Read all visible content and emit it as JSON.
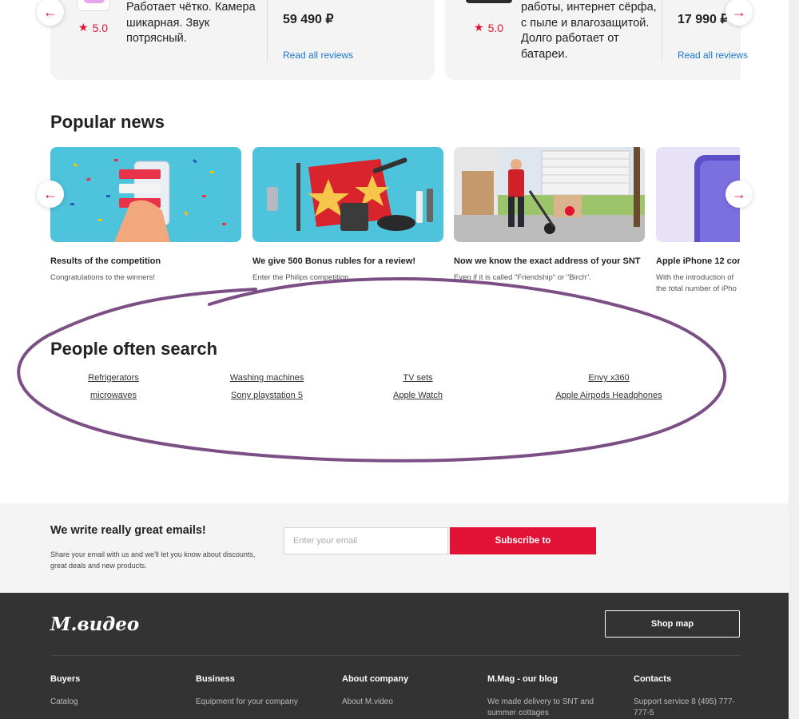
{
  "reviews": [
    {
      "rating": "5.0",
      "text": "Работает чётко. Камера шикарная. Звук потрясный.",
      "price": "59 490 ₽",
      "read_all": "Read all reviews"
    },
    {
      "rating": "5.0",
      "text": "работы, интернет сёрфа, с пыле и влагозащитой. Долго работает от батареи.",
      "price": "17 990 ₽",
      "read_all": "Read all reviews"
    }
  ],
  "popular_news": {
    "heading": "Popular news",
    "items": [
      {
        "title": "Results of the competition",
        "subtitle": "Congratulations to the winners!"
      },
      {
        "title": "We give 500 Bonus rubles for a review!",
        "subtitle": "Enter the Philips competition"
      },
      {
        "title": "Now we know the exact address of your SNT",
        "subtitle": "Even if it is called \"Friendship\" or \"Birch\"."
      },
      {
        "title": "Apple iPhone 12 con",
        "subtitle": "With the introduction of the total number of iPho"
      }
    ]
  },
  "people_search": {
    "heading": "People often search",
    "links": [
      "Refrigerators",
      "Washing machines",
      "TV sets",
      "Envy x360",
      "microwaves",
      "Sony playstation 5",
      "Apple Watch",
      "Apple Airpods Headphones"
    ]
  },
  "subscribe": {
    "title": "We write really great emails!",
    "text": "Share your email with us and we'll let you know about discounts, great deals and new products.",
    "placeholder": "Enter your email",
    "button": "Subscribe to"
  },
  "footer": {
    "logo": "М.видео",
    "shop_map": "Shop map",
    "columns": [
      {
        "title": "Buyers",
        "item": "Catalog"
      },
      {
        "title": "Business",
        "item": "Equipment for your company"
      },
      {
        "title": "About company",
        "item": "About M.video"
      },
      {
        "title": "M.Mag - our blog",
        "item": "We made delivery to SNT and summer cottages"
      },
      {
        "title": "Contacts",
        "item": "Support service 8 (495) 777-777-5"
      }
    ]
  },
  "icons": {
    "arrow_left": "←",
    "arrow_right": "→",
    "star": "★"
  },
  "colors": {
    "accent": "#e21237",
    "link": "#1a78d6",
    "footer_bg": "#333333",
    "annotation": "#7b4f86"
  }
}
